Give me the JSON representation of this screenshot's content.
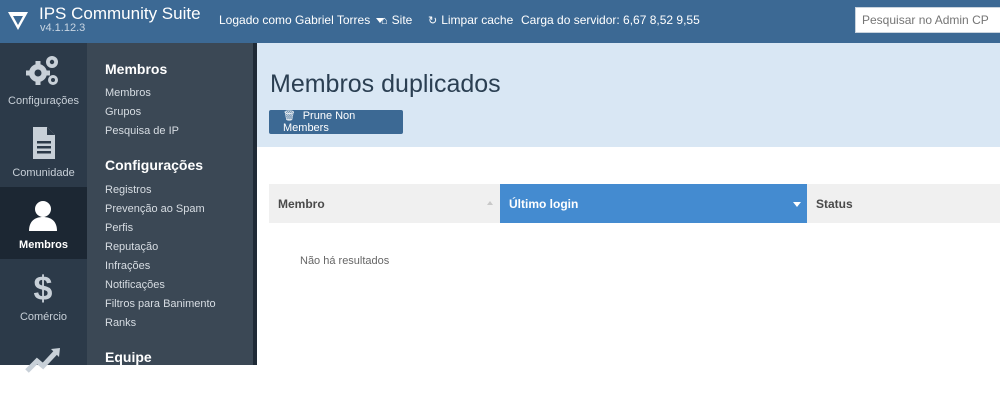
{
  "header": {
    "brand_title": "IPS Community Suite",
    "brand_version": "v4.1.12.3",
    "logged_as": "Logado como Gabriel Torres",
    "site": "Site",
    "clear_cache": "Limpar cache",
    "server_load": "Carga do servidor: 6,67 8,52 9,55",
    "search_placeholder": "Pesquisar no Admin CP"
  },
  "iconbar": {
    "items": [
      {
        "label": "Configurações",
        "icon": "gears-icon"
      },
      {
        "label": "Comunidade",
        "icon": "document-icon"
      },
      {
        "label": "Membros",
        "icon": "user-icon",
        "active": true
      },
      {
        "label": "Comércio",
        "icon": "dollar-icon"
      },
      {
        "label": "",
        "icon": "chart-icon"
      }
    ]
  },
  "subnav": {
    "sections": [
      {
        "title": "Membros",
        "links": [
          "Membros",
          "Grupos",
          "Pesquisa de IP"
        ]
      },
      {
        "title": "Configurações",
        "links": [
          "Registros",
          "Prevenção ao Spam",
          "Perfis",
          "Reputação",
          "Infrações",
          "Notificações",
          "Filtros para Banimento",
          "Ranks"
        ]
      },
      {
        "title": "Equipe",
        "links": []
      }
    ]
  },
  "main": {
    "title": "Membros duplicados",
    "prune_button": "Prune Non Members",
    "table": {
      "columns": [
        "Membro",
        "Último login",
        "Status"
      ],
      "empty_text": "Não há resultados"
    }
  },
  "colors": {
    "header_bg": "#3c6994",
    "sidebar_bg": "#2c3a49",
    "subnav_bg": "#3b4855",
    "accent": "#448bd0",
    "main_head_bg": "#d9e7f4"
  }
}
